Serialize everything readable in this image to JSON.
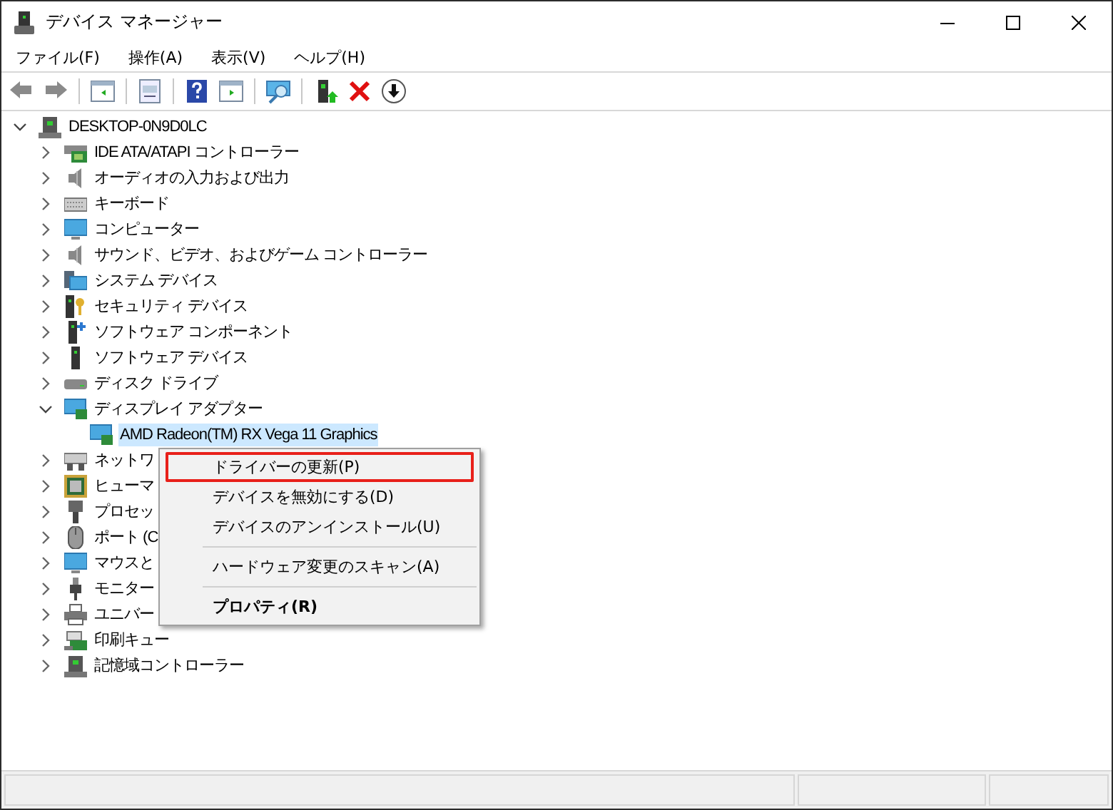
{
  "window": {
    "title": "デバイス マネージャー"
  },
  "menu_bar": [
    "ファイル(F)",
    "操作(A)",
    "表示(V)",
    "ヘルプ(H)"
  ],
  "tree": {
    "label": "DESKTOP-0N9D0LC",
    "expanded": true,
    "selected": false,
    "children": [
      {
        "label": "IDE ATA/ATAPI コントローラー",
        "expanded": false,
        "selected": false
      },
      {
        "label": "オーディオの入力および出力",
        "expanded": false,
        "selected": false
      },
      {
        "label": "キーボード",
        "expanded": false,
        "selected": false
      },
      {
        "label": "コンピューター",
        "expanded": false,
        "selected": false
      },
      {
        "label": "サウンド、ビデオ、およびゲーム コントローラー",
        "expanded": false,
        "selected": false
      },
      {
        "label": "システム デバイス",
        "expanded": false,
        "selected": false
      },
      {
        "label": "セキュリティ デバイス",
        "expanded": false,
        "selected": false
      },
      {
        "label": "ソフトウェア コンポーネント",
        "expanded": false,
        "selected": false
      },
      {
        "label": "ソフトウェア デバイス",
        "expanded": false,
        "selected": false
      },
      {
        "label": "ディスク ドライブ",
        "expanded": false,
        "selected": false
      },
      {
        "label": "ディスプレイ アダプター",
        "expanded": true,
        "selected": false,
        "children": [
          {
            "label": "AMD Radeon(TM) RX Vega 11 Graphics",
            "selected": true
          }
        ]
      },
      {
        "label": "ネットワ",
        "expanded": false,
        "selected": false
      },
      {
        "label": "ヒューマ",
        "expanded": false,
        "selected": false
      },
      {
        "label": "プロセッ",
        "expanded": false,
        "selected": false
      },
      {
        "label": "ポート (C",
        "expanded": false,
        "selected": false
      },
      {
        "label": "マウスと",
        "expanded": false,
        "selected": false
      },
      {
        "label": "モニター",
        "expanded": false,
        "selected": false
      },
      {
        "label": "ユニバー",
        "expanded": false,
        "selected": false
      },
      {
        "label": "印刷キュー",
        "expanded": false,
        "selected": false
      },
      {
        "label": "記憶域コントローラー",
        "expanded": false,
        "selected": false
      }
    ]
  },
  "context_menu": [
    {
      "kind": "item",
      "label": "ドライバーの更新(P)",
      "highlighted": true,
      "default": false
    },
    {
      "kind": "item",
      "label": "デバイスを無効にする(D)",
      "highlighted": false,
      "default": false
    },
    {
      "kind": "item",
      "label": "デバイスのアンインストール(U)",
      "highlighted": false,
      "default": false
    },
    {
      "kind": "separator"
    },
    {
      "kind": "item",
      "label": "ハードウェア変更のスキャン(A)",
      "highlighted": false,
      "default": false
    },
    {
      "kind": "separator"
    },
    {
      "kind": "item",
      "label": "プロパティ(R)",
      "highlighted": false,
      "default": true
    }
  ]
}
